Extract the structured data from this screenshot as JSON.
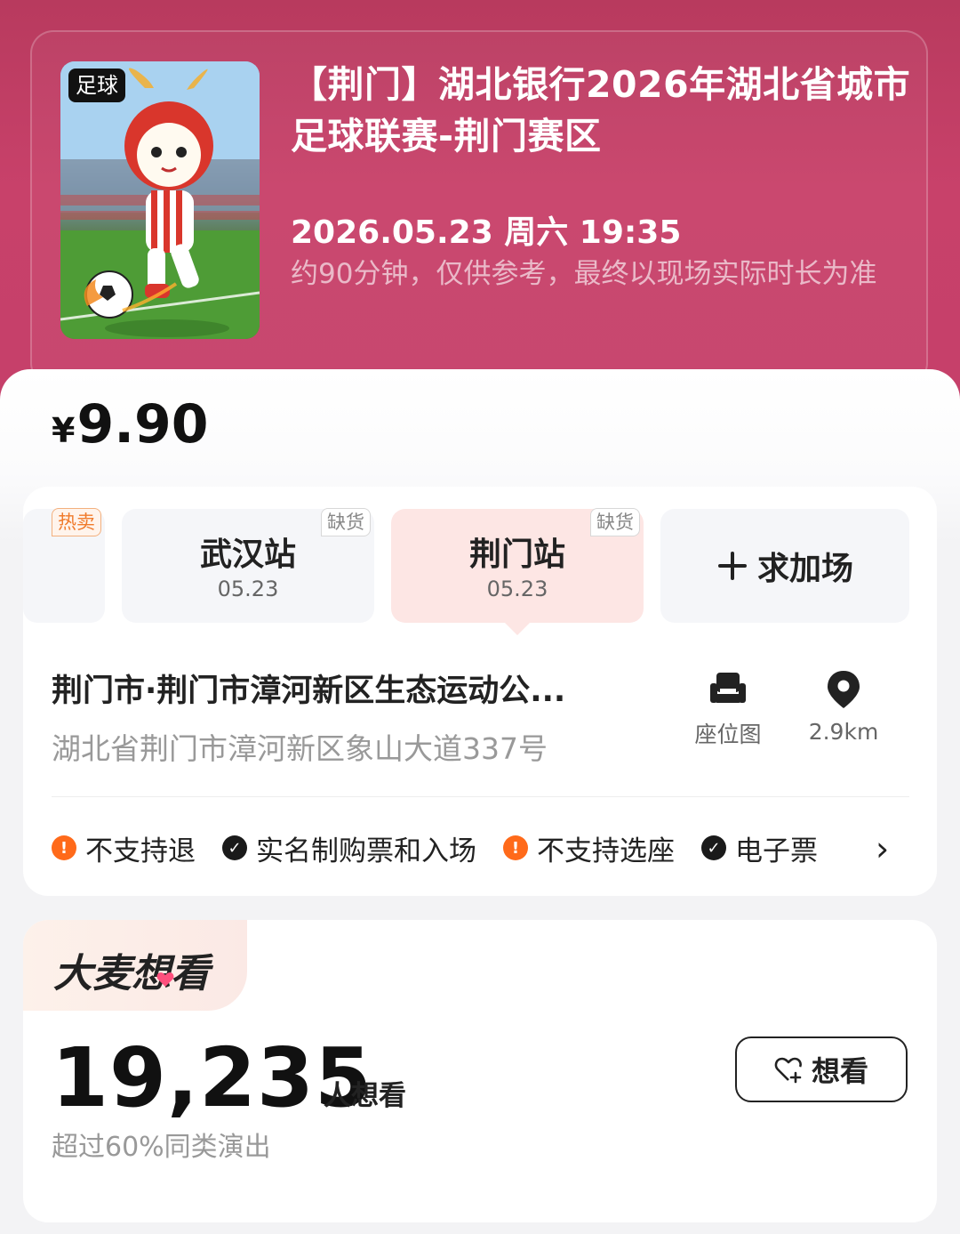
{
  "event": {
    "poster_tag": "足球",
    "title": "【荆门】湖北银行2026年湖北省城市足球联赛-荆门赛区",
    "datetime": "2026.05.23 周六 19:35",
    "duration_note": "约90分钟，仅供参考，最终以现场实际时长为准"
  },
  "price": {
    "symbol": "¥",
    "amount": "9.90"
  },
  "sessions": [
    {
      "badge": "热卖",
      "badge_type": "hot"
    },
    {
      "name": "武汉站",
      "date": "05.23",
      "badge": "缺货"
    },
    {
      "name": "荆门站",
      "date": "05.23",
      "badge": "缺货",
      "selected": true
    },
    {
      "name": "求加场",
      "icon": "plus-icon"
    }
  ],
  "venue": {
    "name": "荆门市·荆门市漳河新区生态运动公...",
    "address": "湖北省荆门市漳河新区象山大道337号",
    "seat_map_label": "座位图",
    "distance": "2.9km"
  },
  "policies": [
    {
      "label": "不支持退",
      "type": "warn"
    },
    {
      "label": "实名制购票和入场",
      "type": "ok"
    },
    {
      "label": "不支持选座",
      "type": "warn"
    },
    {
      "label": "电子票",
      "type": "ok"
    }
  ],
  "want": {
    "section_title": "大麦想看",
    "count": "19,235",
    "count_unit": "人想看",
    "comparison": "超过60%同类演出",
    "button_label": "想看"
  },
  "colors": {
    "hero": "#c5406a",
    "warn": "#ff6a1a",
    "selected_session_bg": "#fde6e4",
    "hot_badge": "#f07b2c"
  }
}
